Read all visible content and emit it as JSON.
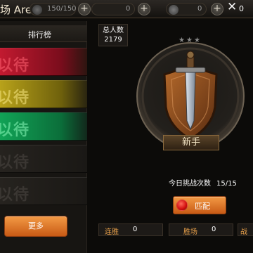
{
  "header": {
    "title": "场 Arena",
    "stamina": "150/150",
    "resource_1": "0",
    "resource_2": "0",
    "close_count": "0"
  },
  "leaderboard": {
    "title": "排行榜",
    "slots": [
      {
        "label": "以待",
        "color": "#a0182a"
      },
      {
        "label": "以待",
        "color": "#9c8a13"
      },
      {
        "label": "以待",
        "color": "#0c8a4a"
      },
      {
        "label": "以待",
        "color": "#2a2622"
      },
      {
        "label": "以待",
        "color": "#2a2622"
      }
    ],
    "more_label": "更多"
  },
  "total": {
    "label": "总人数",
    "value": "2179"
  },
  "rank": {
    "name": "新手"
  },
  "challenge": {
    "label": "今日挑战次数",
    "value": "15/15",
    "match_label": "匹配"
  },
  "stats": [
    {
      "label": "连胜",
      "value": "0"
    },
    {
      "label": "胜场",
      "value": "0"
    },
    {
      "label": "战",
      "value": ""
    }
  ],
  "icons": [
    "stamina-icon",
    "plus-icon",
    "coin-icon",
    "close-icon",
    "star-icon",
    "sword-shield-emblem-icon",
    "red-orb-icon"
  ]
}
